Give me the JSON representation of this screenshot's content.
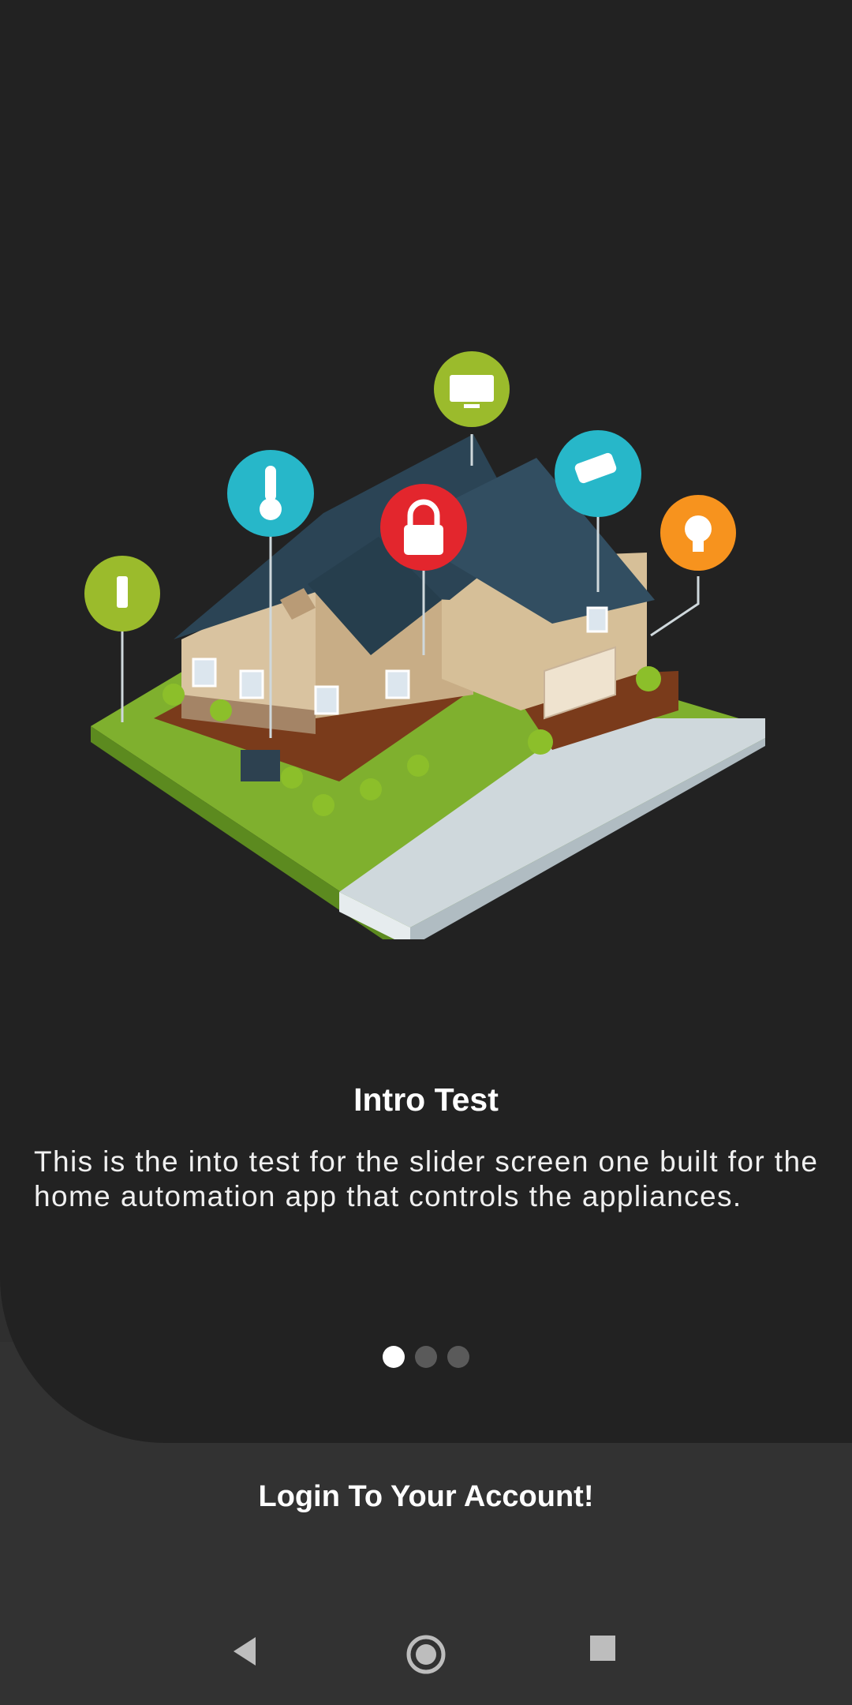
{
  "intro": {
    "title": "Intro Test",
    "description": "This is the into test for the slider screen one built for the home automation app that controls the appliances."
  },
  "pager": {
    "total": 3,
    "active": 0
  },
  "login": {
    "label": "Login To Your Account!"
  },
  "icons": {
    "sprinkler": "sprinkler-icon",
    "thermometer": "thermometer-icon",
    "lock": "lock-icon",
    "tv": "tv-icon",
    "camera": "security-camera-icon",
    "bulb": "lightbulb-icon"
  },
  "colors": {
    "background": "#222222",
    "bottom_panel": "#323232",
    "green": "#9bbb2c",
    "teal": "#27b7c9",
    "red": "#e3262d",
    "orange": "#f7931e"
  }
}
